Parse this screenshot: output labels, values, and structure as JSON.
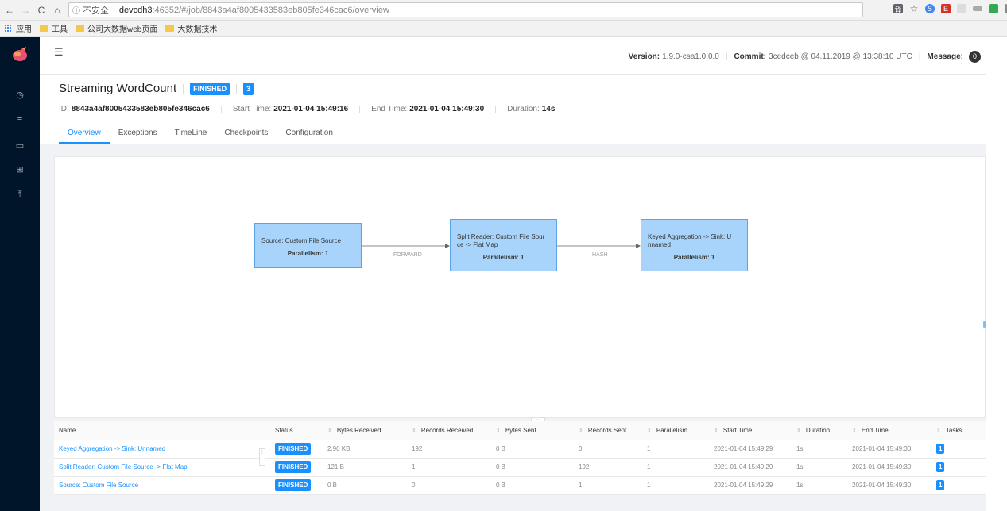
{
  "browser": {
    "url_insecure": "不安全",
    "url_host": "devcdh3",
    "url_path": ":46352/#/job/8843a4af8005433583eb805fe346cac6/overview",
    "bookmarks": [
      "应用",
      "工具",
      "公司大数据web页面",
      "大数据技术"
    ]
  },
  "header": {
    "version_label": "Version:",
    "version_value": "1.9.0-csa1.0.0.0",
    "commit_label": "Commit:",
    "commit_value": "3cedceb @ 04.11.2019 @ 13:38:10 UTC",
    "message_label": "Message:",
    "message_count": "0"
  },
  "job": {
    "name": "Streaming WordCount",
    "status": "FINISHED",
    "task_count": "3",
    "id_label": "ID:",
    "id_value": "8843a4af8005433583eb805fe346cac6",
    "start_label": "Start Time:",
    "start_value": "2021-01-04 15:49:16",
    "end_label": "End Time:",
    "end_value": "2021-01-04 15:49:30",
    "duration_label": "Duration:",
    "duration_value": "14s"
  },
  "tabs": [
    "Overview",
    "Exceptions",
    "TimeLine",
    "Checkpoints",
    "Configuration"
  ],
  "graph": {
    "nodes": [
      {
        "title": "Source: Custom File Source",
        "parallelism": "Parallelism: 1"
      },
      {
        "title": "Split Reader: Custom File Sour ce -> Flat Map",
        "parallelism": "Parallelism: 1"
      },
      {
        "title": "Keyed Aggregation -> Sink: U nnamed",
        "parallelism": "Parallelism: 1"
      }
    ],
    "edges": [
      "FORWARD",
      "HASH"
    ]
  },
  "table": {
    "headers": [
      "Name",
      "Status",
      "Bytes Received",
      "Records Received",
      "Bytes Sent",
      "Records Sent",
      "Parallelism",
      "Start Time",
      "Duration",
      "End Time",
      "Tasks"
    ],
    "rows": [
      [
        "Keyed Aggregation -> Sink: Unnamed",
        "FINISHED",
        "2.90 KB",
        "192",
        "0 B",
        "0",
        "1",
        "2021-01-04 15:49:29",
        "1s",
        "2021-01-04 15:49:30",
        "1"
      ],
      [
        "Split Reader: Custom File Source -> Flat Map",
        "FINISHED",
        "121 B",
        "1",
        "0 B",
        "192",
        "1",
        "2021-01-04 15:49:29",
        "1s",
        "2021-01-04 15:49:30",
        "1"
      ],
      [
        "Source: Custom File Source",
        "FINISHED",
        "0 B",
        "0",
        "0 B",
        "1",
        "1",
        "2021-01-04 15:49:29",
        "1s",
        "2021-01-04 15:49:30",
        "1"
      ]
    ]
  },
  "colors": {
    "primary": "#1890ff",
    "sidebar": "#001529",
    "node_fill": "#a8d4fb",
    "node_border": "#5ba4e6"
  }
}
